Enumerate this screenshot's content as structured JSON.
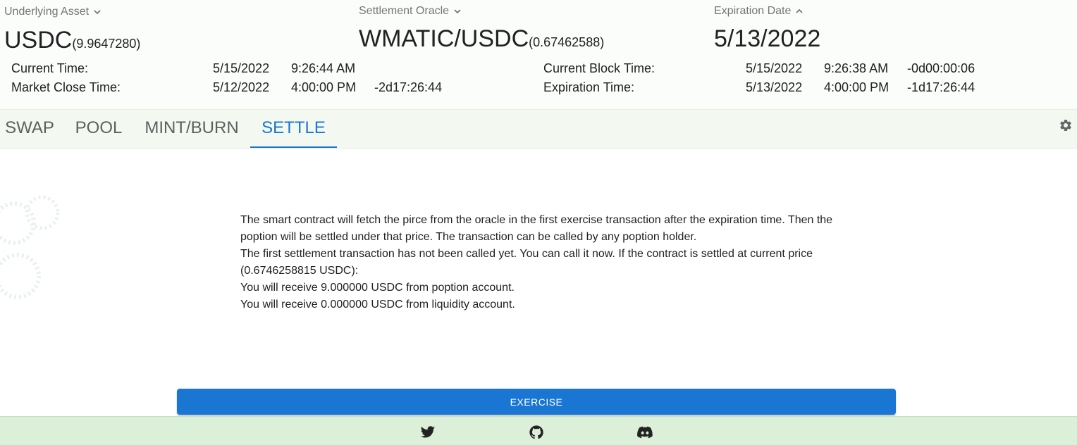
{
  "header": {
    "underlying": {
      "label": "Underlying Asset",
      "symbol": "USDC",
      "price": "(9.9647280)"
    },
    "oracle": {
      "label": "Settlement Oracle",
      "pair": "WMATIC/USDC",
      "price": "(0.67462588)"
    },
    "expiration": {
      "label": "Expiration Date",
      "date": "5/13/2022"
    }
  },
  "times": {
    "current_time": {
      "label": "Current Time:",
      "date": "5/15/2022",
      "time": "9:26:44 AM"
    },
    "market_close": {
      "label": "Market Close Time:",
      "date": "5/12/2022",
      "time": "4:00:00 PM",
      "delta": "-2d17:26:44"
    },
    "current_block": {
      "label": "Current Block Time:",
      "date": "5/15/2022",
      "time": "9:26:38 AM",
      "delta": "-0d00:00:06"
    },
    "expiration_time": {
      "label": "Expiration Time:",
      "date": "5/13/2022",
      "time": "4:00:00 PM",
      "delta": "-1d17:26:44"
    }
  },
  "tabs": [
    "SWAP",
    "POOL",
    "MINT/BURN",
    "SETTLE"
  ],
  "active_tab": "SETTLE",
  "settle": {
    "para1": "The smart contract will fetch the pirce from the oracle in the first exercise transaction after the expiration time. Then the poption will be settled under that price. The transaction can be called by any poption holder.",
    "para2": "The first settlement transaction has not been called yet. You can call it now. If the contract is settled at current price (0.6746258815 USDC):",
    "para3": "You will receive 9.000000 USDC from poption account.",
    "para4": "You will receive 0.000000 USDC from liquidity account.",
    "button": "EXERCISE"
  },
  "footer_icons": [
    "twitter-icon",
    "github-icon",
    "discord-icon"
  ],
  "colors": {
    "accent": "#1976d2",
    "footer_bg": "#dcefd8",
    "tabs_bg": "#f3f9f1"
  }
}
